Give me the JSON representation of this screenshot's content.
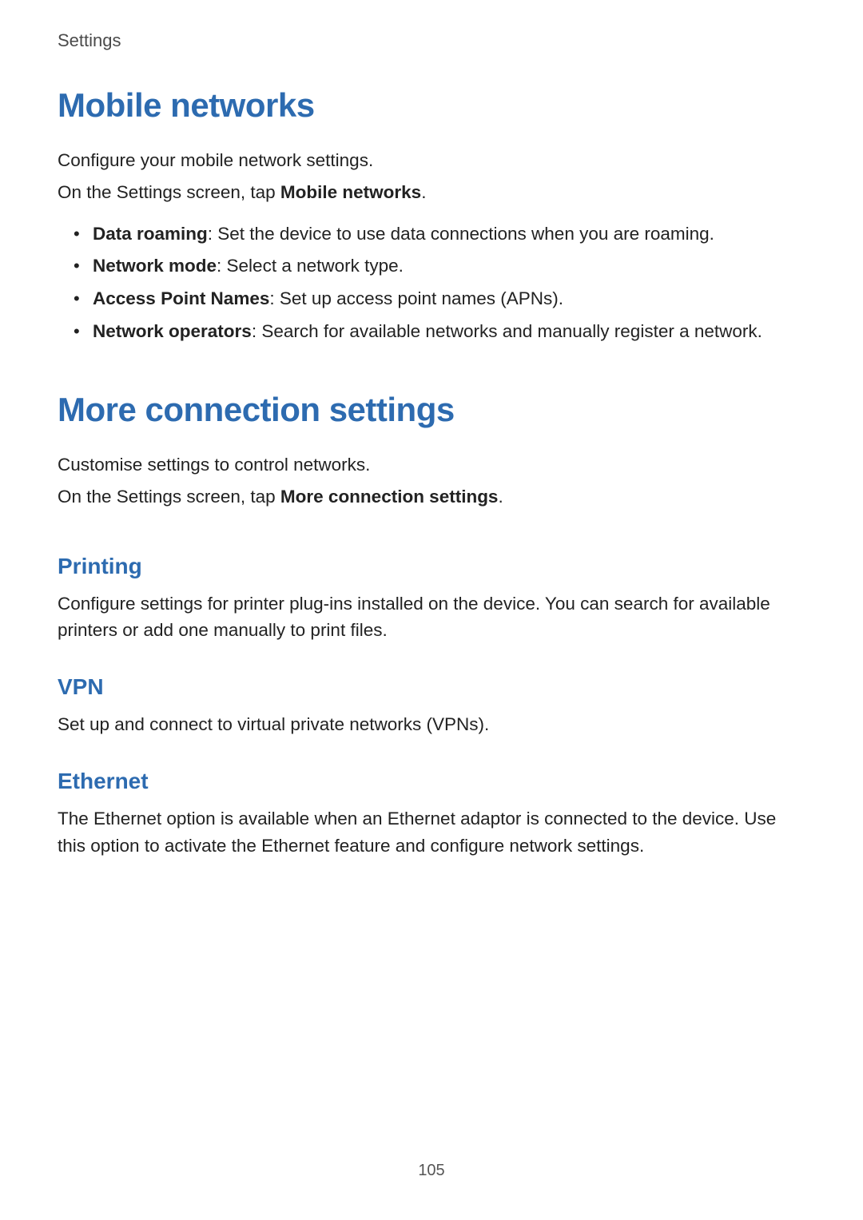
{
  "header": {
    "section_label": "Settings"
  },
  "mobile_networks": {
    "title": "Mobile networks",
    "intro1": "Configure your mobile network settings.",
    "intro2_pre": "On the Settings screen, tap ",
    "intro2_bold": "Mobile networks",
    "intro2_post": ".",
    "items": [
      {
        "bold": "Data roaming",
        "text": ": Set the device to use data connections when you are roaming."
      },
      {
        "bold": "Network mode",
        "text": ": Select a network type."
      },
      {
        "bold": "Access Point Names",
        "text": ": Set up access point names (APNs)."
      },
      {
        "bold": "Network operators",
        "text": ": Search for available networks and manually register a network."
      }
    ]
  },
  "more_conn": {
    "title": "More connection settings",
    "intro1": "Customise settings to control networks.",
    "intro2_pre": "On the Settings screen, tap ",
    "intro2_bold": "More connection settings",
    "intro2_post": ".",
    "printing": {
      "title": "Printing",
      "text": "Configure settings for printer plug-ins installed on the device. You can search for available printers or add one manually to print files."
    },
    "vpn": {
      "title": "VPN",
      "text": "Set up and connect to virtual private networks (VPNs)."
    },
    "ethernet": {
      "title": "Ethernet",
      "text": "The Ethernet option is available when an Ethernet adaptor is connected to the device. Use this option to activate the Ethernet feature and configure network settings."
    }
  },
  "page_number": "105"
}
